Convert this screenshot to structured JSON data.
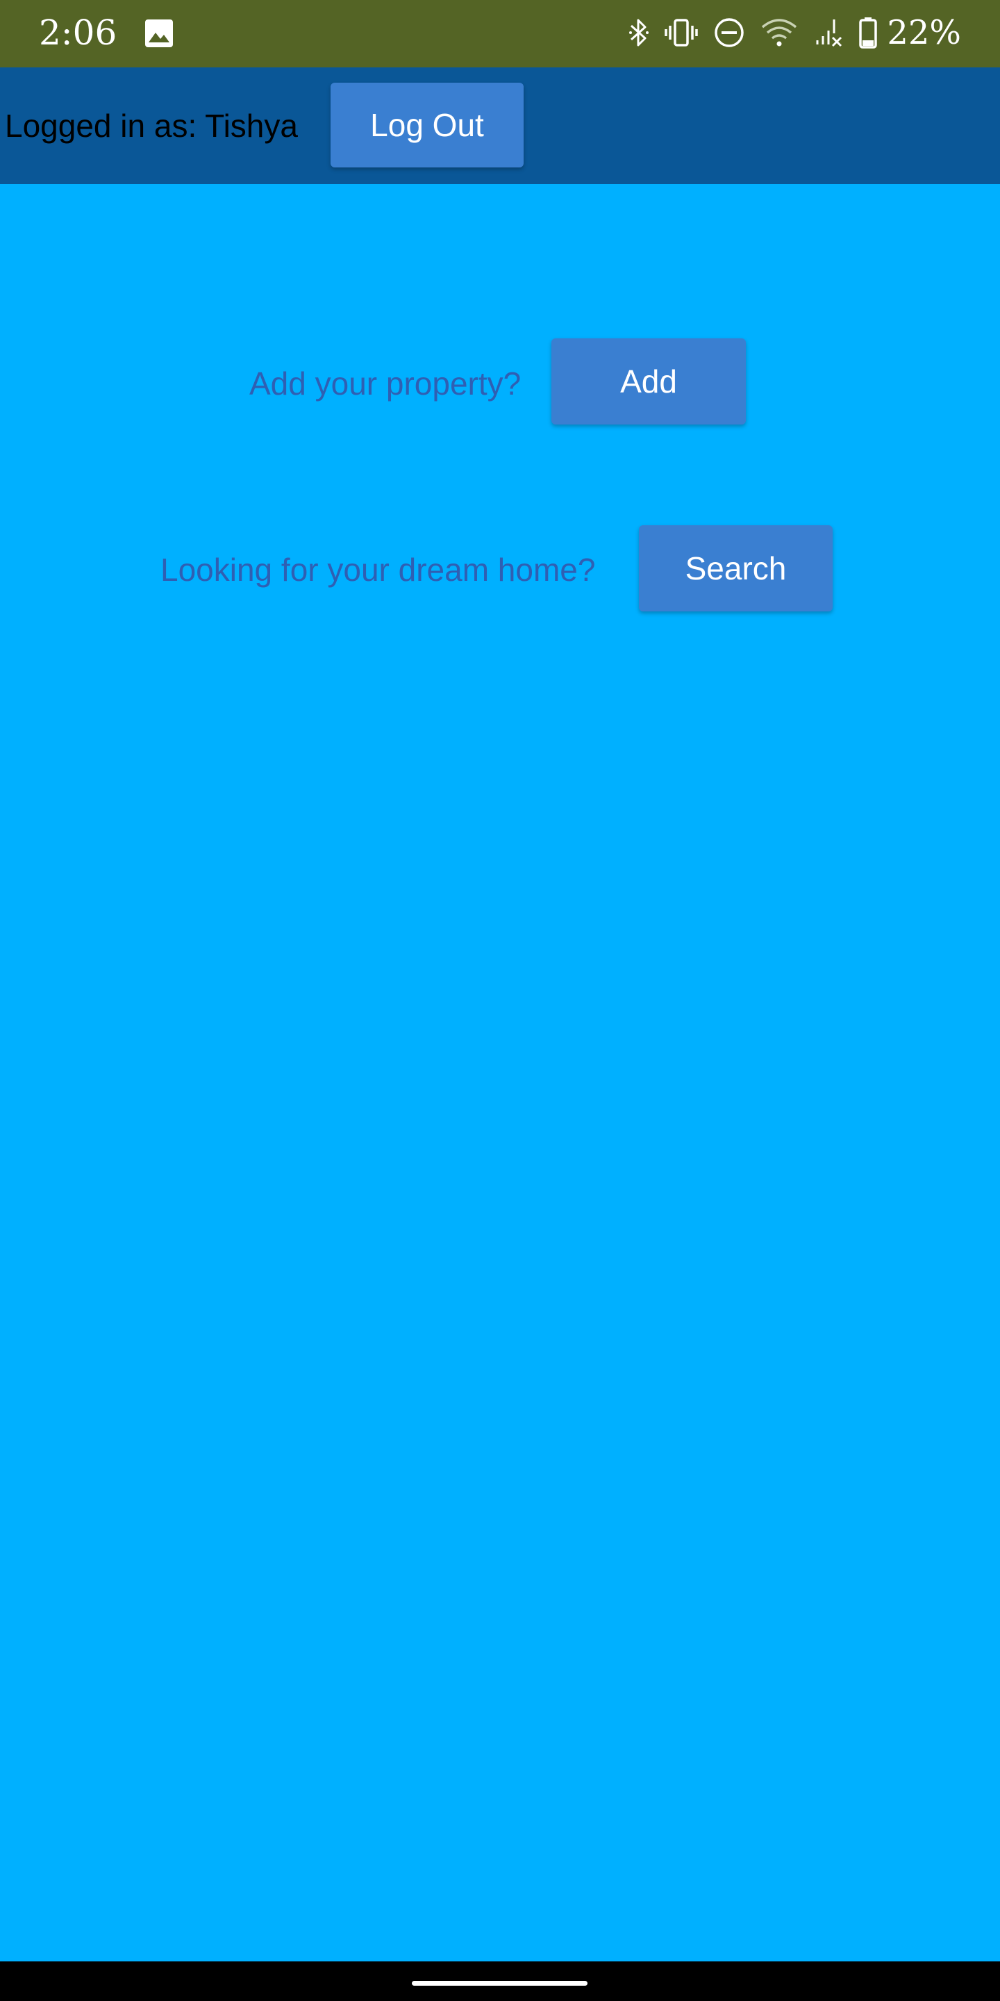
{
  "status_bar": {
    "time": "2:06",
    "battery_percent": "22%",
    "icons": [
      "gallery-icon",
      "bluetooth-icon",
      "vibrate-icon",
      "do-not-disturb-icon",
      "wifi-icon",
      "cell-signal-icon",
      "battery-icon"
    ],
    "background": "#546425"
  },
  "header": {
    "logged_in_text": "Logged in as: Tishya",
    "logout_label": "Log Out",
    "background": "#0a5797"
  },
  "main": {
    "add_prompt": "Add your property?",
    "add_label": "Add",
    "search_prompt": "Looking for your dream home?",
    "search_label": "Search",
    "background": "#00b0ff",
    "button_color": "#3a7fd1",
    "prompt_color": "#2f5fb3"
  }
}
